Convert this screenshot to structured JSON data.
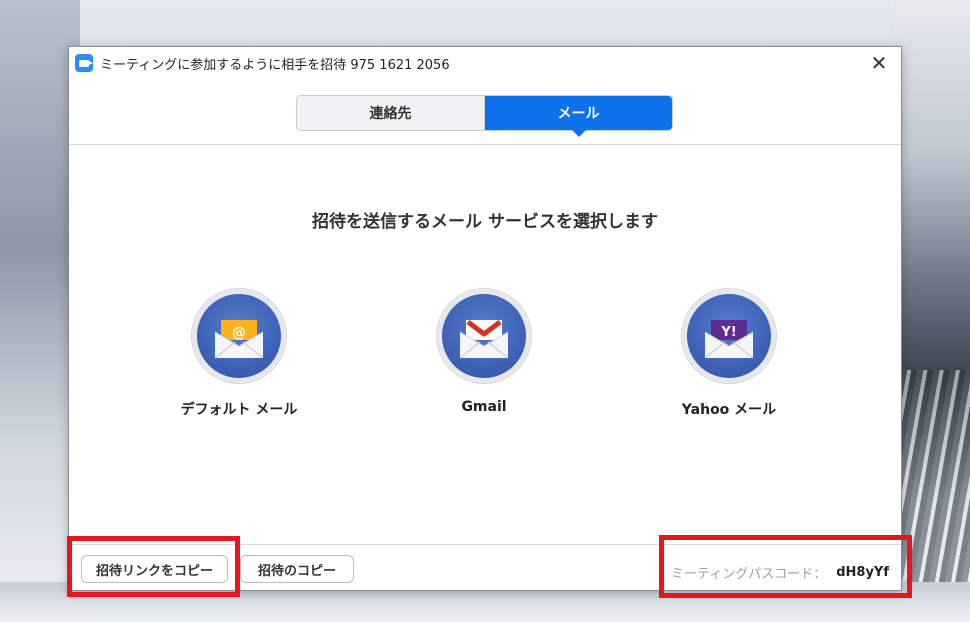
{
  "window": {
    "title": "ミーティングに参加するように相手を招待 975 1621 2056",
    "close_glyph": "✕"
  },
  "tabs": [
    {
      "label": "連絡先",
      "selected": false
    },
    {
      "label": "メール",
      "selected": true
    }
  ],
  "heading": "招待を送信するメール サービスを選択します",
  "services": [
    {
      "label": "デフォルト メール",
      "icon": "default-mail-icon"
    },
    {
      "label": "Gmail",
      "icon": "gmail-icon"
    },
    {
      "label": "Yahoo メール",
      "icon": "yahoo-mail-icon"
    }
  ],
  "footer": {
    "copy_link_label": "招待リンクをコピー",
    "copy_invite_label": "招待のコピー",
    "passcode_label": "ミーティングパスコード：",
    "passcode_value": "dH8yYf"
  },
  "colors": {
    "accent": "#0e72ed",
    "highlight": "#e5161d",
    "icon_circle": "#3d63b8"
  }
}
